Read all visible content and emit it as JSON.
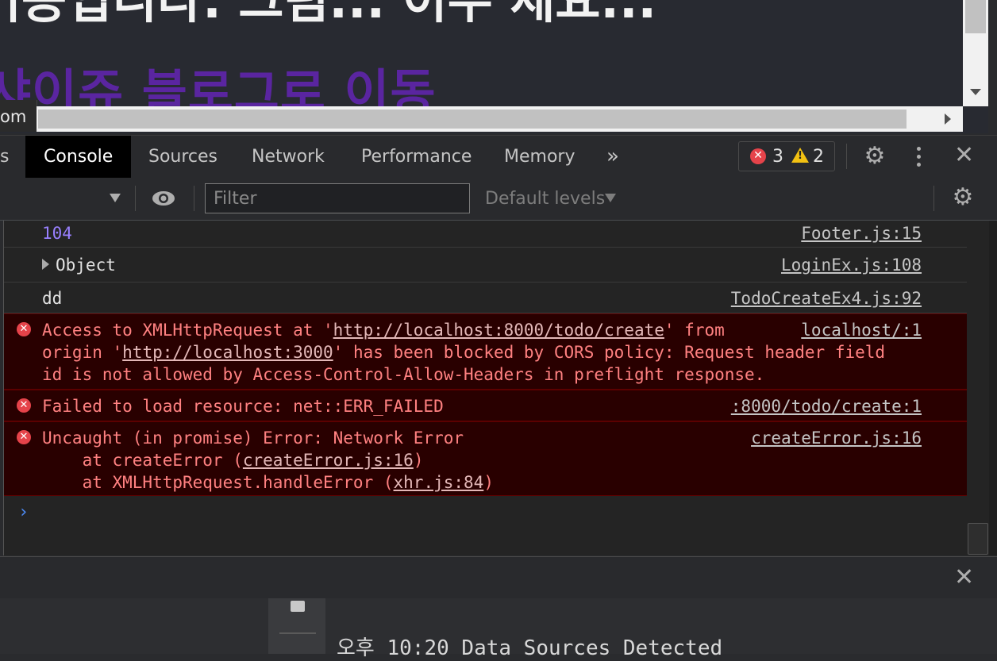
{
  "page": {
    "heading_fragment": "기능입니다. 그럼... 이주 세요...",
    "link_text": "샤이쥬 블로그로 이동",
    "url_tooltip": "om"
  },
  "tabs": {
    "partial_left": "s",
    "items": [
      "Console",
      "Sources",
      "Network",
      "Performance",
      "Memory"
    ],
    "active": "Console",
    "more_glyph": "»"
  },
  "counts": {
    "errors": "3",
    "warnings": "2"
  },
  "filter": {
    "placeholder": "Filter",
    "value": "",
    "levels_label": "Default levels"
  },
  "console": {
    "rows": [
      {
        "type": "log",
        "value": "104",
        "source": "Footer.js:15"
      },
      {
        "type": "log",
        "value": "Object",
        "source": "LoginEx.js:108"
      },
      {
        "type": "log",
        "value": "dd",
        "source": "TodoCreateEx4.js:92"
      }
    ],
    "errors": [
      {
        "line1_pre": "Access to XMLHttpRequest at '",
        "line1_link": "http://localhost:8000/todo/create",
        "line1_post": "' from",
        "line2_pre": "origin '",
        "line2_link": "http://localhost:3000",
        "line2_post": "' has been blocked by CORS policy: Request header field",
        "line3": "id is not allowed by Access-Control-Allow-Headers in preflight response.",
        "source": "localhost/:1"
      },
      {
        "line1": "Failed to load resource: net::ERR_FAILED",
        "source": ":8000/todo/create:1"
      },
      {
        "line1": "Uncaught (in promise) Error: Network Error",
        "line2_pre": "    at createError (",
        "line2_link": "createError.js:16",
        "line2_post": ")",
        "line3_pre": "    at XMLHttpRequest.handleError (",
        "line3_link": "xhr.js:84",
        "line3_post": ")",
        "source": "createError.js:16"
      }
    ],
    "prompt": "›"
  },
  "bottom": {
    "text": "오후 10:20  Data Sources Detected"
  },
  "icons": {
    "error": "error-circle-icon",
    "warning": "warning-triangle-icon",
    "settings": "gear-icon",
    "menu": "kebab-menu-icon",
    "close": "close-icon",
    "eye": "eye-icon"
  },
  "colors": {
    "error_bg": "#290000",
    "error_text": "#ff8181",
    "number": "#9980ff",
    "link_purple": "#5a25a0"
  }
}
